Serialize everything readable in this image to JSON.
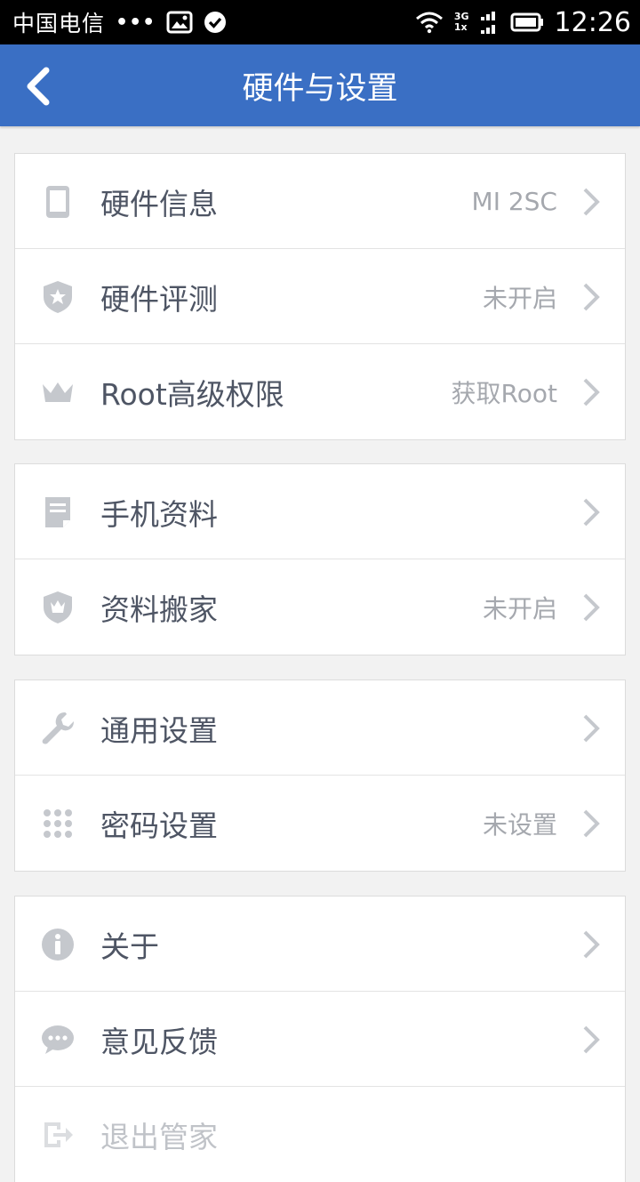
{
  "status_bar": {
    "carrier": "中国电信",
    "dots": "•••",
    "network_top": "3G",
    "network_bottom": "1x",
    "time": "12:26"
  },
  "header": {
    "title": "硬件与设置"
  },
  "groups": [
    [
      {
        "icon": "phone-icon",
        "label": "硬件信息",
        "value": "MI 2SC"
      },
      {
        "icon": "shield-star-icon",
        "label": "硬件评测",
        "value": "未开启"
      },
      {
        "icon": "crown-icon",
        "label": "Root高级权限",
        "value": "获取Root"
      }
    ],
    [
      {
        "icon": "document-icon",
        "label": "手机资料",
        "value": ""
      },
      {
        "icon": "shield-crown-icon",
        "label": "资料搬家",
        "value": "未开启"
      }
    ],
    [
      {
        "icon": "wrench-icon",
        "label": "通用设置",
        "value": ""
      },
      {
        "icon": "keypad-icon",
        "label": "密码设置",
        "value": "未设置"
      }
    ],
    [
      {
        "icon": "info-icon",
        "label": "关于",
        "value": ""
      },
      {
        "icon": "chat-bubble-icon",
        "label": "意见反馈",
        "value": ""
      },
      {
        "icon": "logout-icon",
        "label": "退出管家",
        "value": ""
      }
    ]
  ],
  "colors": {
    "header_bg": "#3a6fc4",
    "icon_gray": "#c5c8cd",
    "label": "#4e5564",
    "value": "#a5a8ae"
  }
}
